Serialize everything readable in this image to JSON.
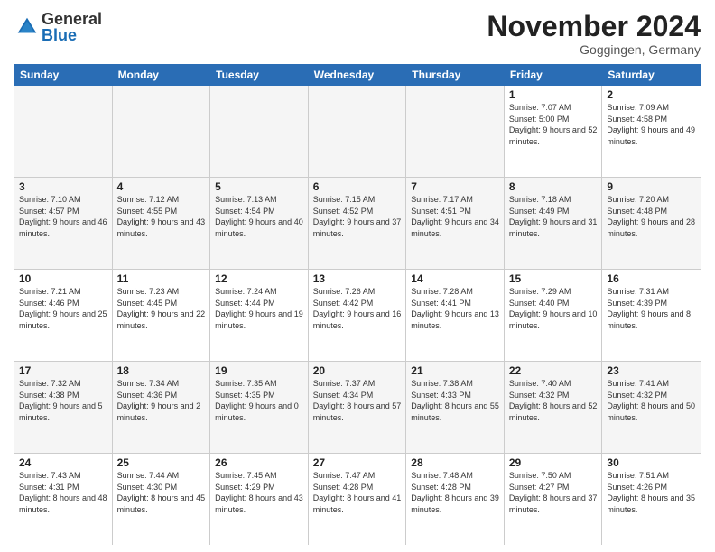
{
  "logo": {
    "general": "General",
    "blue": "Blue"
  },
  "title": "November 2024",
  "location": "Goggingen, Germany",
  "days_of_week": [
    "Sunday",
    "Monday",
    "Tuesday",
    "Wednesday",
    "Thursday",
    "Friday",
    "Saturday"
  ],
  "weeks": [
    {
      "shaded": false,
      "cells": [
        {
          "day": "",
          "empty": true
        },
        {
          "day": "",
          "empty": true
        },
        {
          "day": "",
          "empty": true
        },
        {
          "day": "",
          "empty": true
        },
        {
          "day": "",
          "empty": true
        },
        {
          "day": "1",
          "sunrise": "Sunrise: 7:07 AM",
          "sunset": "Sunset: 5:00 PM",
          "daylight": "Daylight: 9 hours and 52 minutes."
        },
        {
          "day": "2",
          "sunrise": "Sunrise: 7:09 AM",
          "sunset": "Sunset: 4:58 PM",
          "daylight": "Daylight: 9 hours and 49 minutes."
        }
      ]
    },
    {
      "shaded": true,
      "cells": [
        {
          "day": "3",
          "sunrise": "Sunrise: 7:10 AM",
          "sunset": "Sunset: 4:57 PM",
          "daylight": "Daylight: 9 hours and 46 minutes."
        },
        {
          "day": "4",
          "sunrise": "Sunrise: 7:12 AM",
          "sunset": "Sunset: 4:55 PM",
          "daylight": "Daylight: 9 hours and 43 minutes."
        },
        {
          "day": "5",
          "sunrise": "Sunrise: 7:13 AM",
          "sunset": "Sunset: 4:54 PM",
          "daylight": "Daylight: 9 hours and 40 minutes."
        },
        {
          "day": "6",
          "sunrise": "Sunrise: 7:15 AM",
          "sunset": "Sunset: 4:52 PM",
          "daylight": "Daylight: 9 hours and 37 minutes."
        },
        {
          "day": "7",
          "sunrise": "Sunrise: 7:17 AM",
          "sunset": "Sunset: 4:51 PM",
          "daylight": "Daylight: 9 hours and 34 minutes."
        },
        {
          "day": "8",
          "sunrise": "Sunrise: 7:18 AM",
          "sunset": "Sunset: 4:49 PM",
          "daylight": "Daylight: 9 hours and 31 minutes."
        },
        {
          "day": "9",
          "sunrise": "Sunrise: 7:20 AM",
          "sunset": "Sunset: 4:48 PM",
          "daylight": "Daylight: 9 hours and 28 minutes."
        }
      ]
    },
    {
      "shaded": false,
      "cells": [
        {
          "day": "10",
          "sunrise": "Sunrise: 7:21 AM",
          "sunset": "Sunset: 4:46 PM",
          "daylight": "Daylight: 9 hours and 25 minutes."
        },
        {
          "day": "11",
          "sunrise": "Sunrise: 7:23 AM",
          "sunset": "Sunset: 4:45 PM",
          "daylight": "Daylight: 9 hours and 22 minutes."
        },
        {
          "day": "12",
          "sunrise": "Sunrise: 7:24 AM",
          "sunset": "Sunset: 4:44 PM",
          "daylight": "Daylight: 9 hours and 19 minutes."
        },
        {
          "day": "13",
          "sunrise": "Sunrise: 7:26 AM",
          "sunset": "Sunset: 4:42 PM",
          "daylight": "Daylight: 9 hours and 16 minutes."
        },
        {
          "day": "14",
          "sunrise": "Sunrise: 7:28 AM",
          "sunset": "Sunset: 4:41 PM",
          "daylight": "Daylight: 9 hours and 13 minutes."
        },
        {
          "day": "15",
          "sunrise": "Sunrise: 7:29 AM",
          "sunset": "Sunset: 4:40 PM",
          "daylight": "Daylight: 9 hours and 10 minutes."
        },
        {
          "day": "16",
          "sunrise": "Sunrise: 7:31 AM",
          "sunset": "Sunset: 4:39 PM",
          "daylight": "Daylight: 9 hours and 8 minutes."
        }
      ]
    },
    {
      "shaded": true,
      "cells": [
        {
          "day": "17",
          "sunrise": "Sunrise: 7:32 AM",
          "sunset": "Sunset: 4:38 PM",
          "daylight": "Daylight: 9 hours and 5 minutes."
        },
        {
          "day": "18",
          "sunrise": "Sunrise: 7:34 AM",
          "sunset": "Sunset: 4:36 PM",
          "daylight": "Daylight: 9 hours and 2 minutes."
        },
        {
          "day": "19",
          "sunrise": "Sunrise: 7:35 AM",
          "sunset": "Sunset: 4:35 PM",
          "daylight": "Daylight: 9 hours and 0 minutes."
        },
        {
          "day": "20",
          "sunrise": "Sunrise: 7:37 AM",
          "sunset": "Sunset: 4:34 PM",
          "daylight": "Daylight: 8 hours and 57 minutes."
        },
        {
          "day": "21",
          "sunrise": "Sunrise: 7:38 AM",
          "sunset": "Sunset: 4:33 PM",
          "daylight": "Daylight: 8 hours and 55 minutes."
        },
        {
          "day": "22",
          "sunrise": "Sunrise: 7:40 AM",
          "sunset": "Sunset: 4:32 PM",
          "daylight": "Daylight: 8 hours and 52 minutes."
        },
        {
          "day": "23",
          "sunrise": "Sunrise: 7:41 AM",
          "sunset": "Sunset: 4:32 PM",
          "daylight": "Daylight: 8 hours and 50 minutes."
        }
      ]
    },
    {
      "shaded": false,
      "cells": [
        {
          "day": "24",
          "sunrise": "Sunrise: 7:43 AM",
          "sunset": "Sunset: 4:31 PM",
          "daylight": "Daylight: 8 hours and 48 minutes."
        },
        {
          "day": "25",
          "sunrise": "Sunrise: 7:44 AM",
          "sunset": "Sunset: 4:30 PM",
          "daylight": "Daylight: 8 hours and 45 minutes."
        },
        {
          "day": "26",
          "sunrise": "Sunrise: 7:45 AM",
          "sunset": "Sunset: 4:29 PM",
          "daylight": "Daylight: 8 hours and 43 minutes."
        },
        {
          "day": "27",
          "sunrise": "Sunrise: 7:47 AM",
          "sunset": "Sunset: 4:28 PM",
          "daylight": "Daylight: 8 hours and 41 minutes."
        },
        {
          "day": "28",
          "sunrise": "Sunrise: 7:48 AM",
          "sunset": "Sunset: 4:28 PM",
          "daylight": "Daylight: 8 hours and 39 minutes."
        },
        {
          "day": "29",
          "sunrise": "Sunrise: 7:50 AM",
          "sunset": "Sunset: 4:27 PM",
          "daylight": "Daylight: 8 hours and 37 minutes."
        },
        {
          "day": "30",
          "sunrise": "Sunrise: 7:51 AM",
          "sunset": "Sunset: 4:26 PM",
          "daylight": "Daylight: 8 hours and 35 minutes."
        }
      ]
    }
  ]
}
